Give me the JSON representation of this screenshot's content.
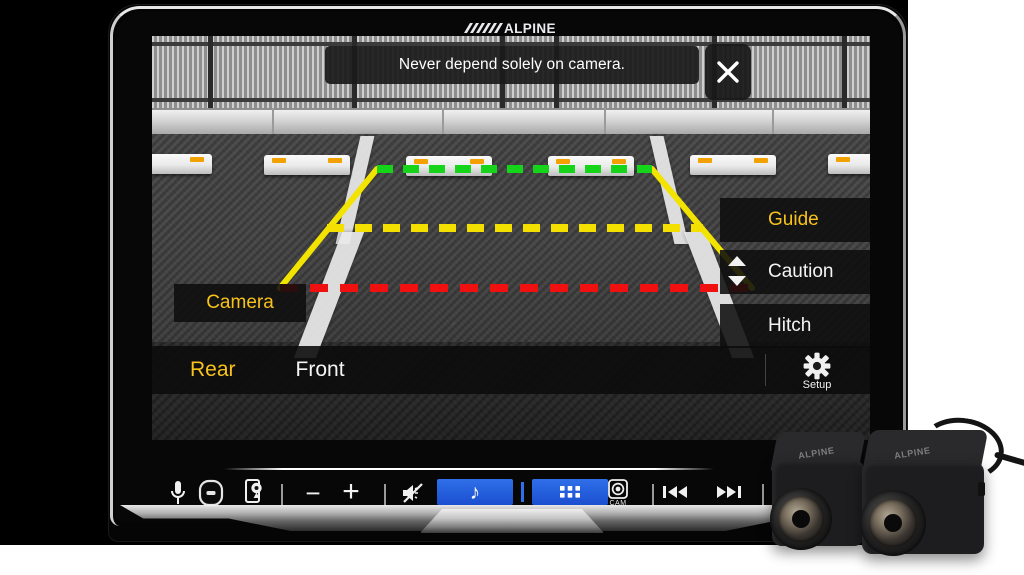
{
  "device": {
    "brand": "ALPINE",
    "screen_name": "rear-camera-view"
  },
  "warning_banner": {
    "message": "Never depend solely on camera.",
    "close_icon": "close-icon"
  },
  "overlay_buttons": {
    "camera": "Camera",
    "guide": "Guide",
    "caution": "Caution",
    "hitch": "Hitch",
    "scroll_indicator_icon": "up-down-arrows-icon"
  },
  "source_bar": {
    "rear": "Rear",
    "front": "Front",
    "setup_label": "Setup",
    "setup_icon": "gear-icon"
  },
  "hardware_keys": [
    {
      "name": "microphone",
      "icon": "microphone-icon",
      "label": ""
    },
    {
      "name": "power-knob",
      "icon": "rotary-knob-icon",
      "label": ""
    },
    {
      "name": "navigation",
      "icon": "map-pin-icon",
      "label": ""
    },
    {
      "name": "volume-down",
      "icon": "minus-icon",
      "label": "−"
    },
    {
      "name": "volume-up",
      "icon": "plus-icon",
      "label": "+"
    },
    {
      "name": "mute",
      "icon": "mute-speaker-icon",
      "label": ""
    },
    {
      "name": "audio",
      "icon": "music-note-icon",
      "label": "♪"
    },
    {
      "name": "apps",
      "icon": "apps-grid-icon",
      "label": ""
    },
    {
      "name": "camera",
      "icon": "camera-icon",
      "label": "CAM"
    },
    {
      "name": "previous-track",
      "icon": "previous-track-icon",
      "label": "⏮"
    },
    {
      "name": "next-track",
      "icon": "next-track-icon",
      "label": "⏭"
    }
  ],
  "colors": {
    "amber_active": "#f7c21b",
    "inactive_white": "#f4f4f4",
    "accent_blue": "#2f6fe8",
    "guide_green": "#16d41a",
    "guide_yellow": "#f3e000",
    "guide_red": "#f01010",
    "guide_side_yellow": "#f2e400"
  },
  "guidelines": {
    "far_line": {
      "color": "#16d41a",
      "style": "dashed",
      "label": "far-distance-green-line"
    },
    "mid_line": {
      "color": "#f3e000",
      "style": "dashed",
      "label": "mid-distance-yellow-line"
    },
    "near_line": {
      "color": "#f01010",
      "style": "dashed",
      "label": "near-distance-red-line"
    },
    "side_lines": {
      "color": "#f2e400",
      "style": "solid",
      "label": "vehicle-width-side-lines"
    }
  },
  "cameras": {
    "count": 2,
    "brand": "ALPINE",
    "name": "backup-camera-product"
  }
}
